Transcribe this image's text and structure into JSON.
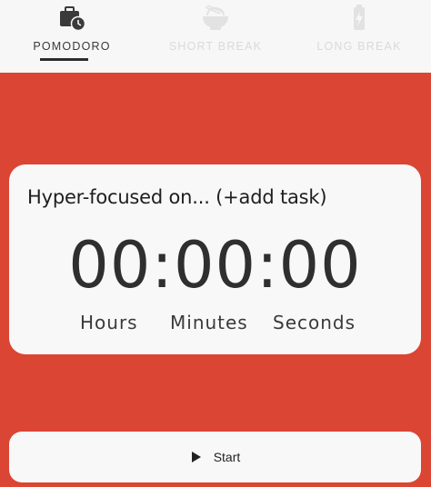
{
  "tabs": [
    {
      "label": "POMODORO",
      "icon": "briefcase-clock-icon",
      "active": true
    },
    {
      "label": "SHORT BREAK",
      "icon": "noodle-bowl-icon",
      "active": false
    },
    {
      "label": "LONG BREAK",
      "icon": "battery-charging-icon",
      "active": false
    }
  ],
  "task": {
    "text": "Hyper-focused on... (+add task)"
  },
  "timer": {
    "display": "00:00:00",
    "units": {
      "hours": "Hours",
      "minutes": "Minutes",
      "seconds": "Seconds"
    }
  },
  "start_button": {
    "label": "Start",
    "icon": "play-icon"
  },
  "colors": {
    "background": "#db4533",
    "card": "#f8f8f8",
    "tabbar": "#f7f7f7"
  }
}
